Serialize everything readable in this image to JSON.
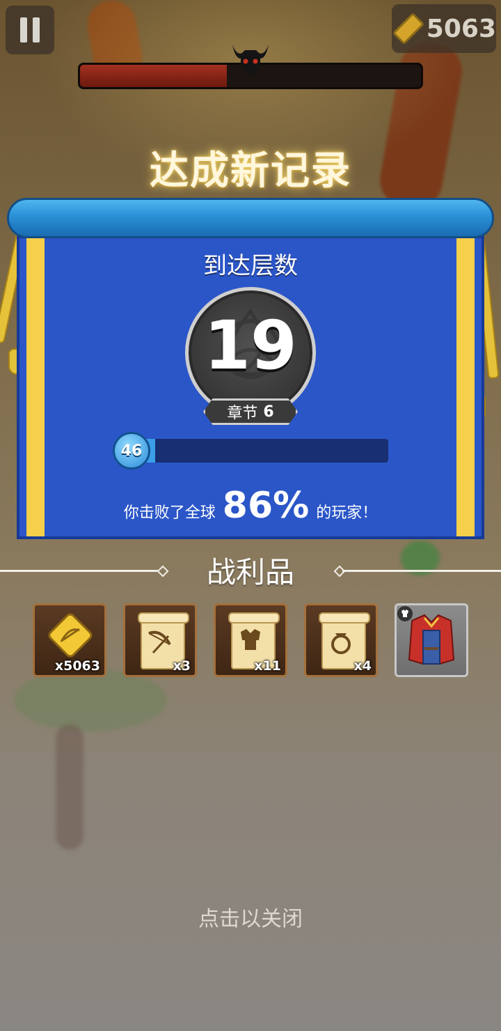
{
  "hud": {
    "gem_count": "5063",
    "boss_health_fraction": 0.43
  },
  "record": {
    "title": "达成新记录"
  },
  "floor": {
    "label": "到达层数",
    "value": "19",
    "chapter_label": "章节",
    "chapter_value": "6"
  },
  "progress": {
    "level": "46",
    "fill_fraction": 0.06
  },
  "beat": {
    "prefix": "你击败了全球",
    "percent": "86%",
    "suffix": "的玩家！"
  },
  "loot": {
    "title": "战利品",
    "items": [
      {
        "icon": "gem-icon",
        "qty": "x5063"
      },
      {
        "icon": "bow-scroll-icon",
        "qty": "x3"
      },
      {
        "icon": "armor-scroll-icon",
        "qty": "x11"
      },
      {
        "icon": "ring-scroll-icon",
        "qty": "x4"
      },
      {
        "icon": "armor-vest-icon",
        "qty": ""
      }
    ]
  },
  "close_hint": "点击以关闭",
  "colors": {
    "panel_blue": "#2b56c8",
    "scroll_rod_blue": "#2a8fd6",
    "stripe_gold": "#f6cf4b",
    "boss_red": "#a2301e"
  }
}
